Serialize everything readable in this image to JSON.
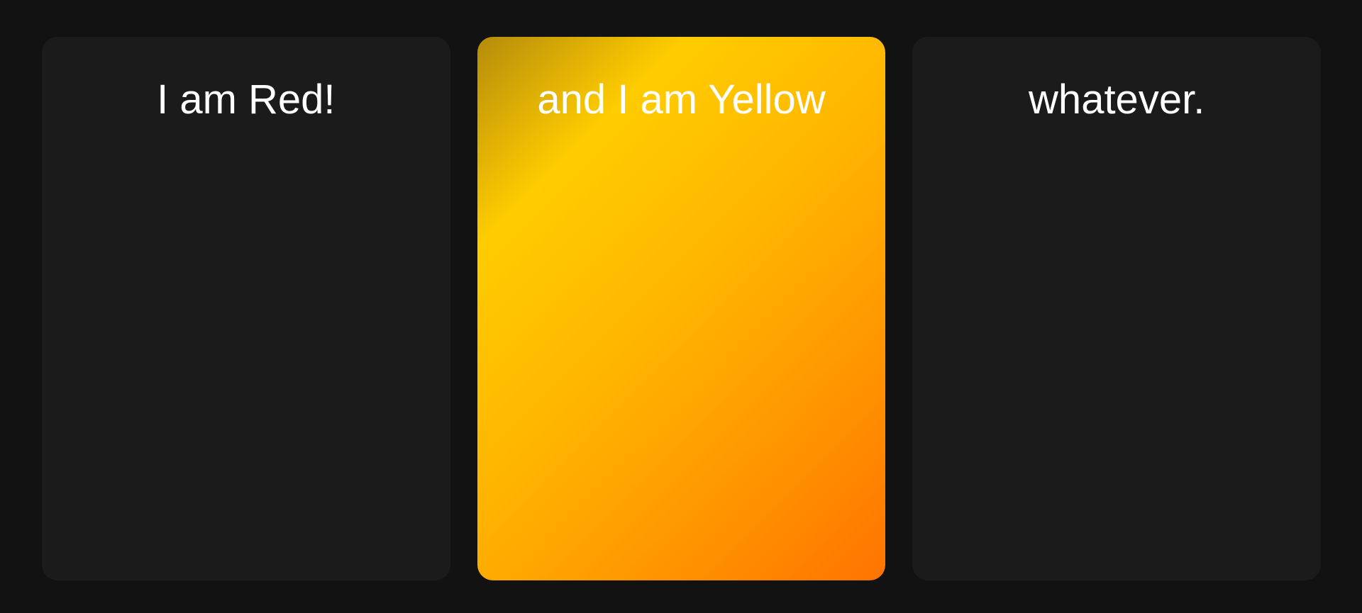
{
  "cards": [
    {
      "title": "I am Red!",
      "color": "#1b1b1b"
    },
    {
      "title": "and I am Yellow",
      "color_start": "#b58c0b",
      "color_mid": "#ffcc00",
      "color_end": "#ff7300"
    },
    {
      "title": "whatever.",
      "color": "#1b1b1b"
    }
  ],
  "background": "#121212"
}
